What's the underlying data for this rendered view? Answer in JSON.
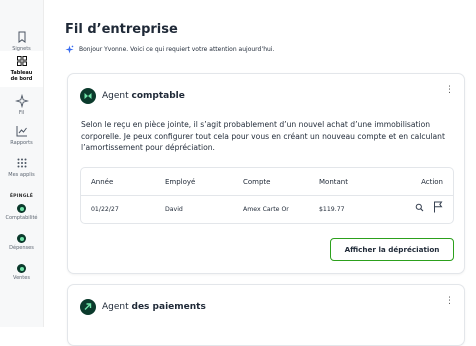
{
  "sidebar": {
    "items": [
      {
        "label": "Signets",
        "icon": "bookmark-icon"
      },
      {
        "label": "Tableau de bord",
        "icon": "dashboard-icon"
      },
      {
        "label": "Fil",
        "icon": "sparkle-icon"
      },
      {
        "label": "Rapports",
        "icon": "chart-icon"
      },
      {
        "label": "Mes applis",
        "icon": "apps-grid-icon"
      }
    ],
    "pinned_label": "ÉPINGLÉ",
    "pinned": [
      {
        "label": "Comptabilité"
      },
      {
        "label": "Dépenses"
      },
      {
        "label": "Ventes"
      }
    ]
  },
  "main": {
    "title": "Fil d’entreprise",
    "greeting": "Bonjour Yvonne. Voici ce qui requiert votre attention aujourd’hui."
  },
  "card_accounting": {
    "agent_prefix": "Agent",
    "agent_name": "comptable",
    "menu_glyph": "⋮",
    "message": "Selon le reçu en pièce jointe, il s’agit probablement d’un nouvel achat d’une immobilisation corporelle. Je peux configurer tout cela pour vous en créant un nouveau compte et en calculant l’amortissement pour dépréciation.",
    "table": {
      "headers": [
        "Année",
        "Employé",
        "Compte",
        "Montant",
        "Action"
      ],
      "row": [
        "01/22/27",
        "David",
        "Amex Carte Or",
        "$119.77"
      ]
    },
    "button_label": "Afficher la dépréciation"
  },
  "card_payments": {
    "agent_prefix": "Agent",
    "agent_name": "des paiements",
    "menu_glyph": "⋮"
  },
  "colors": {
    "accent_green": "#2ca01c",
    "dark_green": "#0b3a2c",
    "mint": "#6fe3a8",
    "sparkle_blue": "#3a6df0"
  }
}
